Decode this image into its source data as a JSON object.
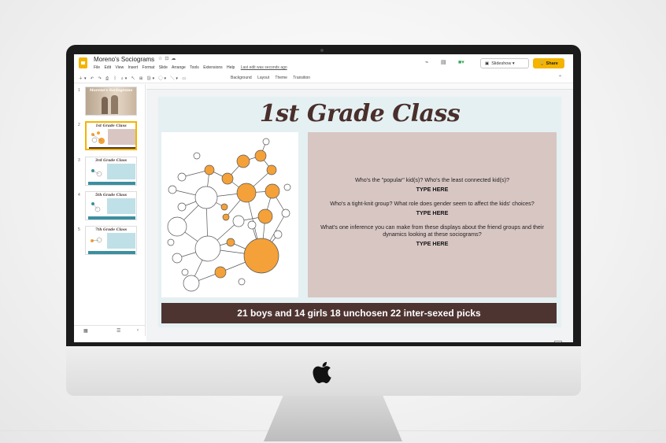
{
  "app": {
    "doc_title": "Moreno's Sociograms",
    "menus": [
      "File",
      "Edit",
      "View",
      "Insert",
      "Format",
      "Slide",
      "Arrange",
      "Tools",
      "Extensions",
      "Help"
    ],
    "last_edit": "Last edit was seconds ago",
    "slideshow_label": "Slideshow",
    "share_label": "Share",
    "toolbar_items": [
      "Background",
      "Layout",
      "Theme",
      "Transition"
    ]
  },
  "filmstrip": {
    "slides": [
      {
        "num": "1",
        "title": "Moreno's Sociograms",
        "selected": false
      },
      {
        "num": "2",
        "title": "1st Grade Class",
        "selected": true
      },
      {
        "num": "3",
        "title": "3rd Grade Class",
        "selected": false
      },
      {
        "num": "4",
        "title": "5th Grade Class",
        "selected": false
      },
      {
        "num": "5",
        "title": "7th Grade Class",
        "selected": false
      }
    ]
  },
  "slide": {
    "title": "1st Grade Class",
    "questions": [
      {
        "q": "Who's the \"popular\" kid(s)? Who's the least connected kid(s)?",
        "answer": "TYPE HERE"
      },
      {
        "q": "Who's a tight-knit group?    What role does gender seem to affect the kids' choices?",
        "answer": "TYPE HERE"
      },
      {
        "q": "What's one inference you can make from these displays about the friend groups and their dynamics looking at these sociograms?",
        "answer": "TYPE HERE"
      }
    ],
    "footer": "21 boys and 14 girls   18 unchosen   22 inter-sexed picks"
  },
  "colors": {
    "accent": "#f4b400",
    "girl_node": "#f4a13a",
    "title_brown": "#4a2f2b",
    "question_bg": "#d8c6c3",
    "footer_bg": "#4e3431"
  }
}
